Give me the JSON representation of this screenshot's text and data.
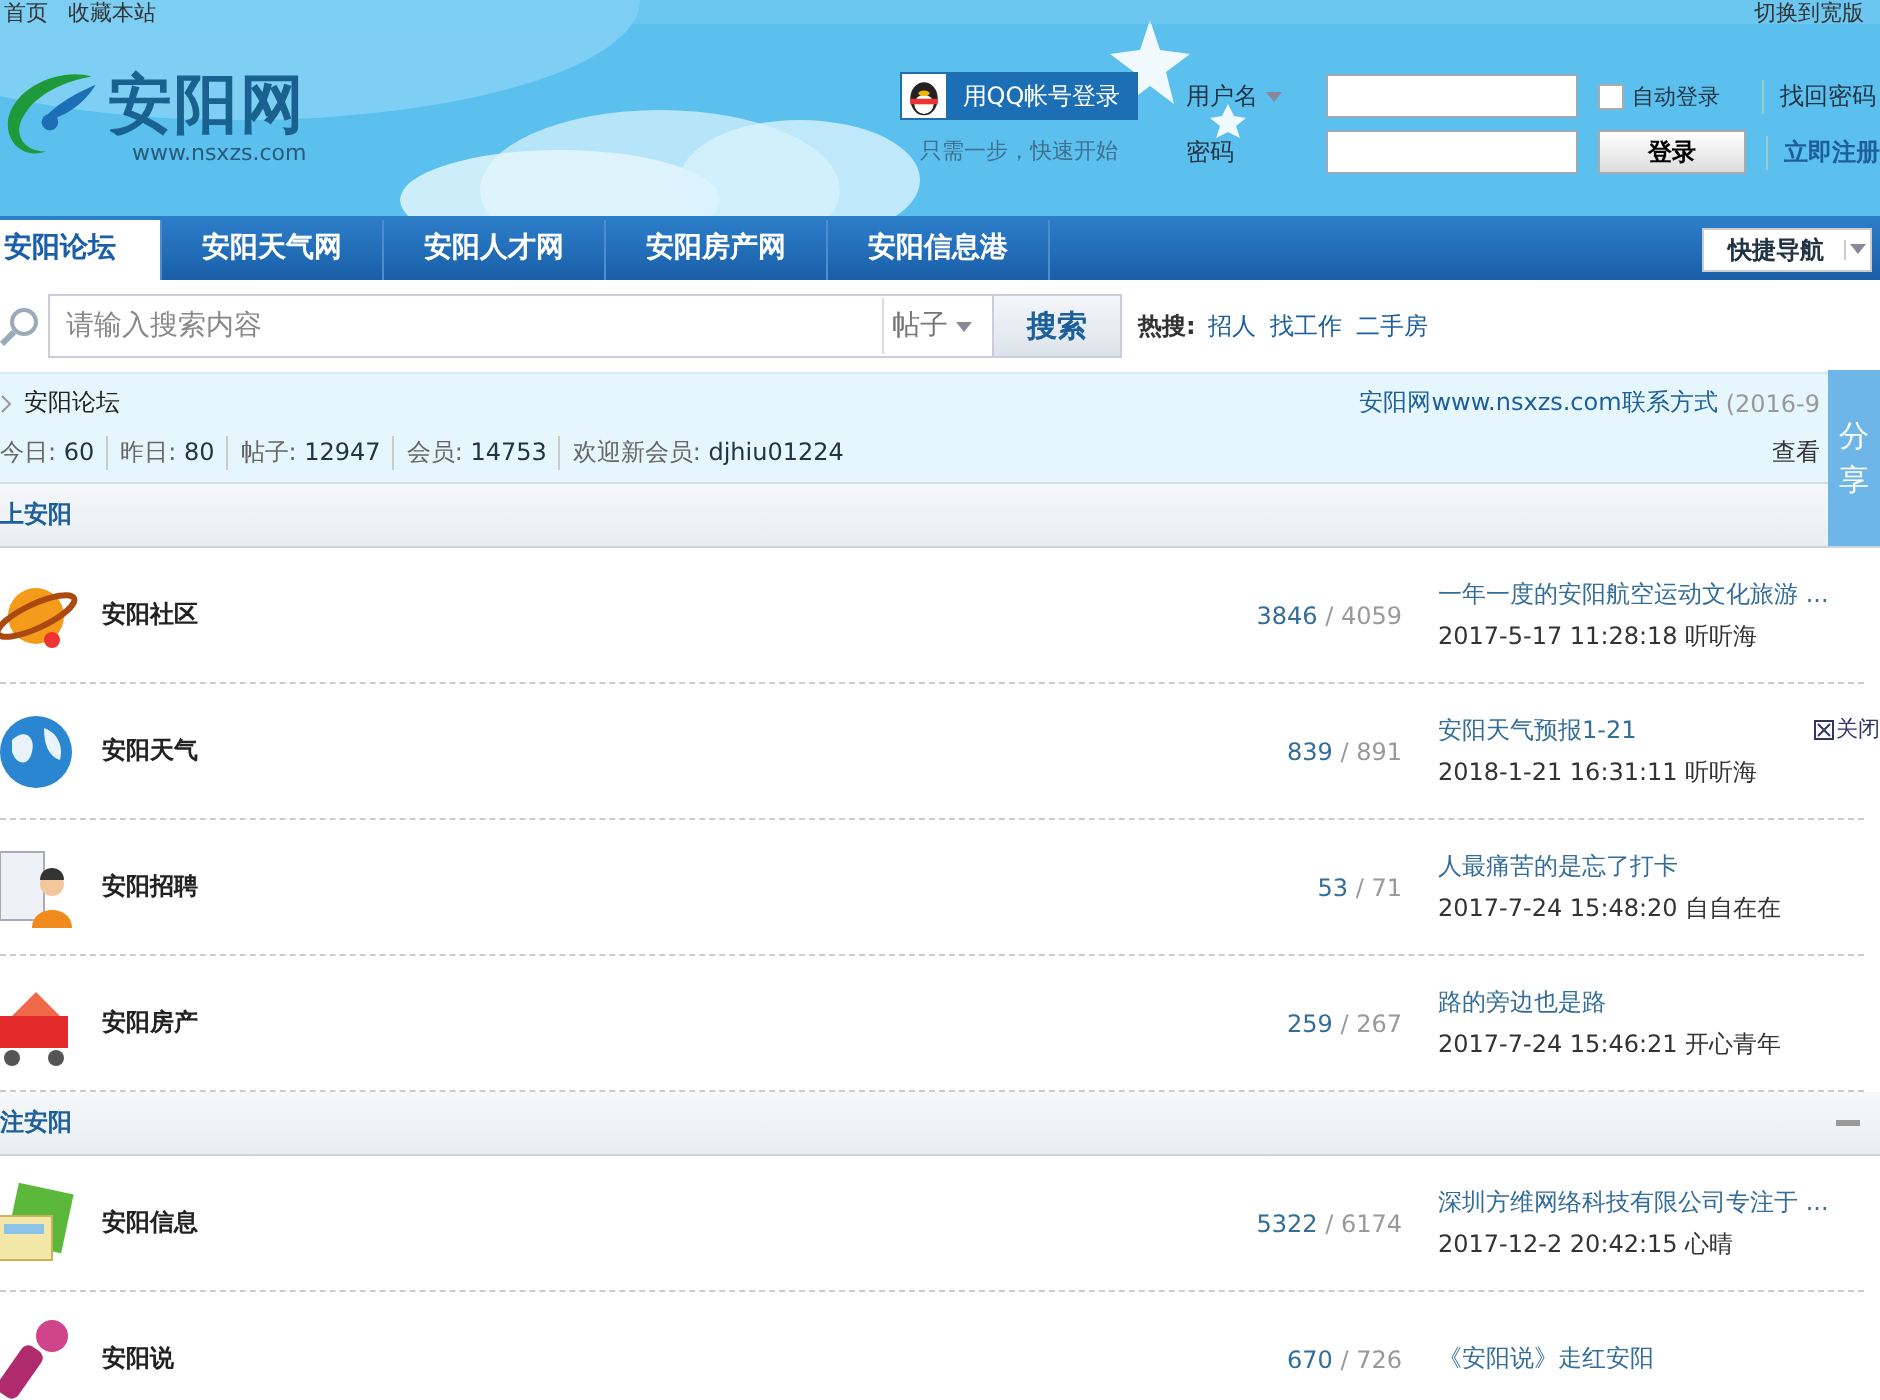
{
  "top_links": [
    "首页",
    "收藏本站"
  ],
  "top_right": "切换到宽版",
  "logo": {
    "title": "安阳网",
    "url": "www.nsxzs.com"
  },
  "qq_login": {
    "label": "用QQ帐号登录",
    "hint": "只需一步，快速开始"
  },
  "login": {
    "username_label": "用户名",
    "password_label": "密码",
    "auto_login": {
      "label": "自动登录",
      "checked": false
    },
    "submit": "登录",
    "links": [
      "找回密码",
      "立即注册"
    ]
  },
  "nav": {
    "tabs": [
      {
        "label": "安阳论坛",
        "selected": true
      },
      {
        "label": "安阳天气网",
        "selected": false
      },
      {
        "label": "安阳人才网",
        "selected": false
      },
      {
        "label": "安阳房产网",
        "selected": false
      },
      {
        "label": "安阳信息港",
        "selected": false
      }
    ],
    "quick_nav": "快捷导航"
  },
  "search": {
    "placeholder": "请输入搜索内容",
    "type": "帖子",
    "button": "搜索",
    "hot_label": "热搜:",
    "hot": [
      "招人",
      "找工作",
      "二手房"
    ]
  },
  "breadcrumb": "安阳论坛",
  "notice": "安阳网www.nsxzs.com联系方式",
  "notice_date": "(2016-9",
  "stats": [
    {
      "label": "今日:",
      "value": "60"
    },
    {
      "label": "昨日:",
      "value": "80"
    },
    {
      "label": "帖子:",
      "value": "12947"
    },
    {
      "label": "会员:",
      "value": "14753"
    },
    {
      "label": "欢迎新会员:",
      "value": "djhiu01224"
    }
  ],
  "view_link": "查看",
  "share": "分享",
  "close": "关闭",
  "sections": [
    {
      "title": "上安阳",
      "forums": [
        {
          "name": "安阳社区",
          "threads": "3846",
          "posts": "/ 4059",
          "last_title": "一年一度的安阳航空运动文化旅游 ...",
          "last_meta": "2017-5-17 11:28:18 听听海"
        },
        {
          "name": "安阳天气",
          "threads": "839",
          "posts": "/ 891",
          "last_title": "安阳天气预报1-21",
          "last_meta": "2018-1-21 16:31:11 听听海"
        },
        {
          "name": "安阳招聘",
          "threads": "53",
          "posts": "/ 71",
          "last_title": "人最痛苦的是忘了打卡",
          "last_meta": "2017-7-24 15:48:20 自自在在"
        },
        {
          "name": "安阳房产",
          "threads": "259",
          "posts": "/ 267",
          "last_title": "路的旁边也是路",
          "last_meta": "2017-7-24 15:46:21 开心青年"
        }
      ]
    },
    {
      "title": "注安阳",
      "collapse": true,
      "forums": [
        {
          "name": "安阳信息",
          "threads": "5322",
          "posts": "/ 6174",
          "last_title": "深圳方维网络科技有限公司专注于 ...",
          "last_meta": "2017-12-2 20:42:15 心晴"
        },
        {
          "name": "安阳说",
          "threads": "670",
          "posts": "/ 726",
          "last_title": "《安阳说》走红安阳"
        }
      ]
    }
  ]
}
